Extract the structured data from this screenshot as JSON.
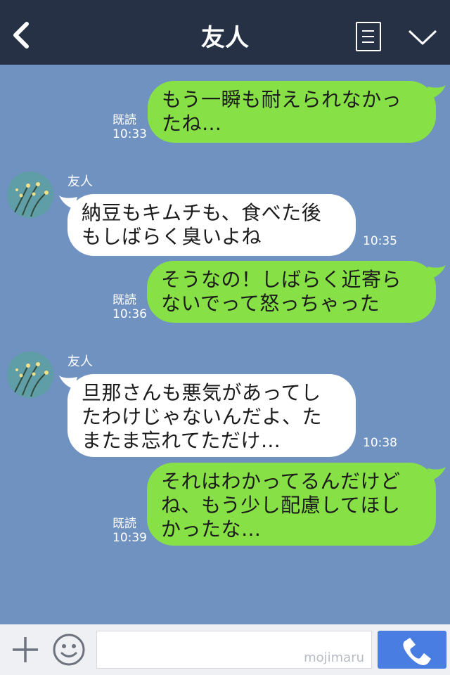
{
  "header": {
    "title": "友人",
    "back_icon": "chevron-left-icon",
    "menu_icon": "menu-list-icon",
    "collapse_icon": "chevron-down-icon",
    "background": "#263146"
  },
  "chat": {
    "background": "#7092c0",
    "outgoing_color": "#86e046",
    "incoming_color": "#ffffff",
    "messages": [
      {
        "direction": "out",
        "lines": [
          "もう一瞬も耐えられなかっ",
          "たね…"
        ],
        "read": "既読",
        "time": "10:33"
      },
      {
        "direction": "in",
        "sender": "友人",
        "lines": [
          "納豆もキムチも、食べた後",
          "もしばらく臭いよね"
        ],
        "time": "10:35"
      },
      {
        "direction": "out",
        "lines": [
          "そうなの！しばらく近寄ら",
          "ないでって怒っちゃった"
        ],
        "read": "既読",
        "time": "10:36"
      },
      {
        "direction": "in",
        "sender": "友人",
        "lines": [
          "旦那さんも悪気があってし",
          "たわけじゃないんだよ、た",
          "またま忘れてただけ…"
        ],
        "time": "10:38"
      },
      {
        "direction": "out",
        "lines": [
          "それはわかってるんだけど",
          "ね、もう少し配慮してほし",
          "かったな…"
        ],
        "read": "既読",
        "time": "10:39"
      }
    ]
  },
  "input_bar": {
    "plus_icon": "plus-icon",
    "sticker_icon": "smiley-icon",
    "watermark": "mojimaru",
    "call_icon": "phone-icon",
    "call_color": "#4a7de2"
  }
}
